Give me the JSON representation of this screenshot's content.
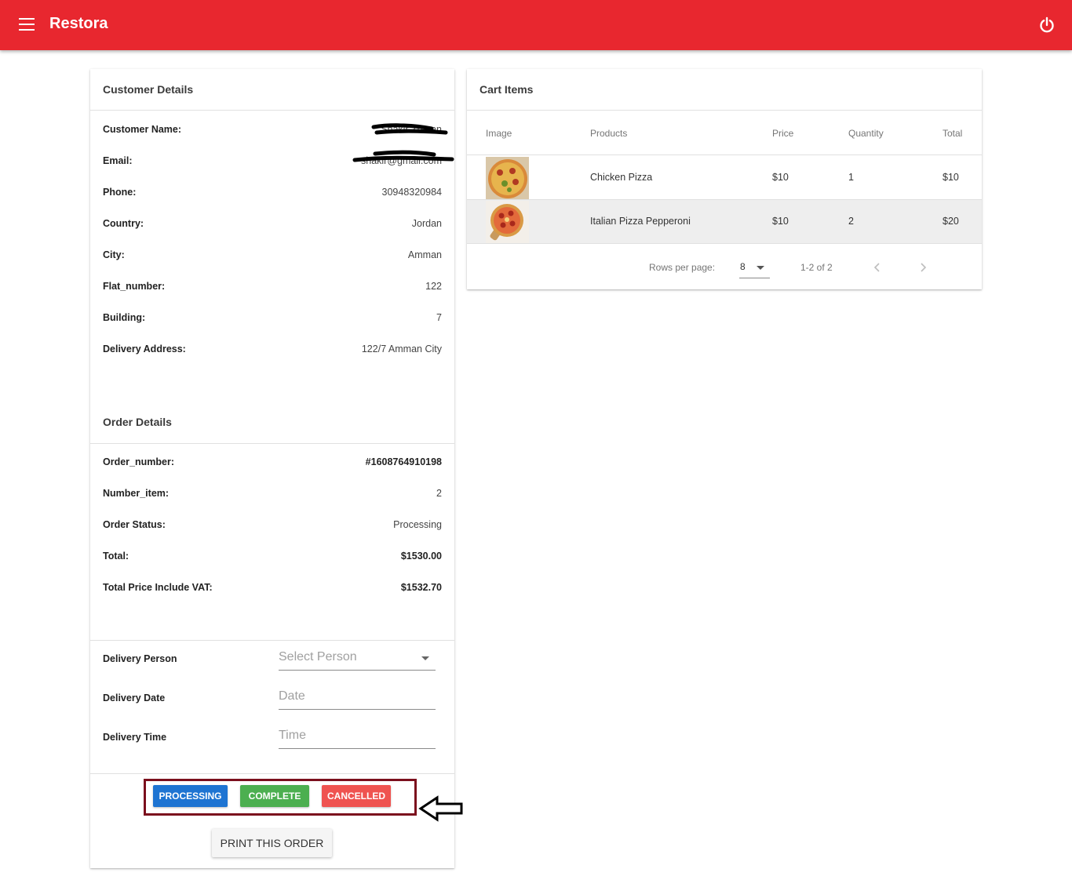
{
  "app": {
    "title": "Restora"
  },
  "customer": {
    "header": "Customer Details",
    "rows": [
      {
        "label": "Customer Name:",
        "value": "Shakir Zoman"
      },
      {
        "label": "Email:",
        "value": "shakir@gmail.com"
      },
      {
        "label": "Phone:",
        "value": "30948320984"
      },
      {
        "label": "Country:",
        "value": "Jordan"
      },
      {
        "label": "City:",
        "value": "Amman"
      },
      {
        "label": "Flat_number:",
        "value": "122"
      },
      {
        "label": "Building:",
        "value": "7"
      },
      {
        "label": "Delivery Address:",
        "value": "122/7 Amman City"
      }
    ]
  },
  "order": {
    "header": "Order Details",
    "rows": [
      {
        "label": "Order_number:",
        "value": "#1608764910198"
      },
      {
        "label": "Number_item:",
        "value": "2"
      },
      {
        "label": "Order Status:",
        "value": "Processing"
      },
      {
        "label": "Total:",
        "value": "$1530.00"
      },
      {
        "label": "Total Price Include VAT:",
        "value": "$1532.70"
      }
    ]
  },
  "delivery": {
    "person_label": "Delivery Person",
    "person_placeholder": "Select Person",
    "date_label": "Delivery Date",
    "date_placeholder": "Date",
    "time_label": "Delivery Time",
    "time_placeholder": "Time"
  },
  "actions": {
    "processing": "PROCESSING",
    "complete": "COMPLETE",
    "cancelled": "CANCELLED",
    "print": "PRINT THIS ORDER"
  },
  "cart": {
    "header": "Cart Items",
    "columns": [
      "Image",
      "Products",
      "Price",
      "Quantity",
      "Total"
    ],
    "items": [
      {
        "image": "pizza-image",
        "product": "Chicken Pizza",
        "price": "$10",
        "quantity": "1",
        "total": "$10"
      },
      {
        "image": "pizza-image",
        "product": "Italian Pizza Pepperoni",
        "price": "$10",
        "quantity": "2",
        "total": "$20"
      }
    ],
    "pagination": {
      "rows_per_page_label": "Rows per page:",
      "rows_per_page": "8",
      "range": "1-2 of 2"
    }
  },
  "colors": {
    "appbar": "#e8272f",
    "processing": "#1e74d2",
    "complete": "#4caf50",
    "cancelled": "#ef5350",
    "highlight_box": "#7b0f1d"
  },
  "icons": [
    "menu-icon",
    "power-icon",
    "chevron-left-icon",
    "chevron-right-icon",
    "arrow-left-icon"
  ]
}
